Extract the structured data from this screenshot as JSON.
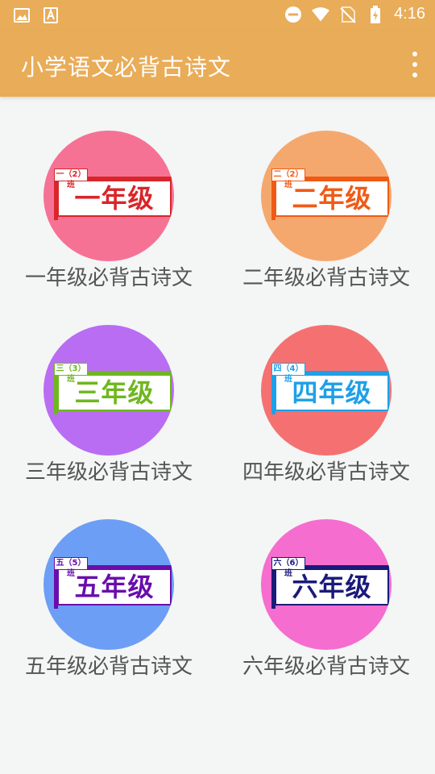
{
  "status_bar": {
    "time": "4:16",
    "icons": [
      "image-icon",
      "text-icon",
      "do-not-disturb-icon",
      "wifi-icon",
      "no-sim-icon",
      "battery-icon"
    ]
  },
  "app_bar": {
    "title": "小学语文必背古诗文",
    "menu_icon": "more-vert-icon"
  },
  "colors": {
    "app_bar": "#e9ac58",
    "background": "#f4f5f5"
  },
  "grades": [
    {
      "label": "一年级必背古诗文",
      "tab_text": "一（2）班",
      "grade_text": "一年级",
      "circle_color": "#f57295",
      "accent": "#d8262a"
    },
    {
      "label": "二年级必背古诗文",
      "tab_text": "二（2）班",
      "grade_text": "二年级",
      "circle_color": "#f5a86d",
      "accent": "#f05a15"
    },
    {
      "label": "三年级必背古诗文",
      "tab_text": "三（3）班",
      "grade_text": "三年级",
      "circle_color": "#b96df2",
      "accent": "#6fb71e"
    },
    {
      "label": "四年级必背古诗文",
      "tab_text": "四（4）班",
      "grade_text": "四年级",
      "circle_color": "#f57171",
      "accent": "#1ea0e8"
    },
    {
      "label": "五年级必背古诗文",
      "tab_text": "五（5）班",
      "grade_text": "五年级",
      "circle_color": "#6d9ef5",
      "accent": "#6a0dab"
    },
    {
      "label": "六年级必背古诗文",
      "tab_text": "六（6）班",
      "grade_text": "六年级",
      "circle_color": "#f56dcf",
      "accent": "#1a1a7a"
    }
  ]
}
